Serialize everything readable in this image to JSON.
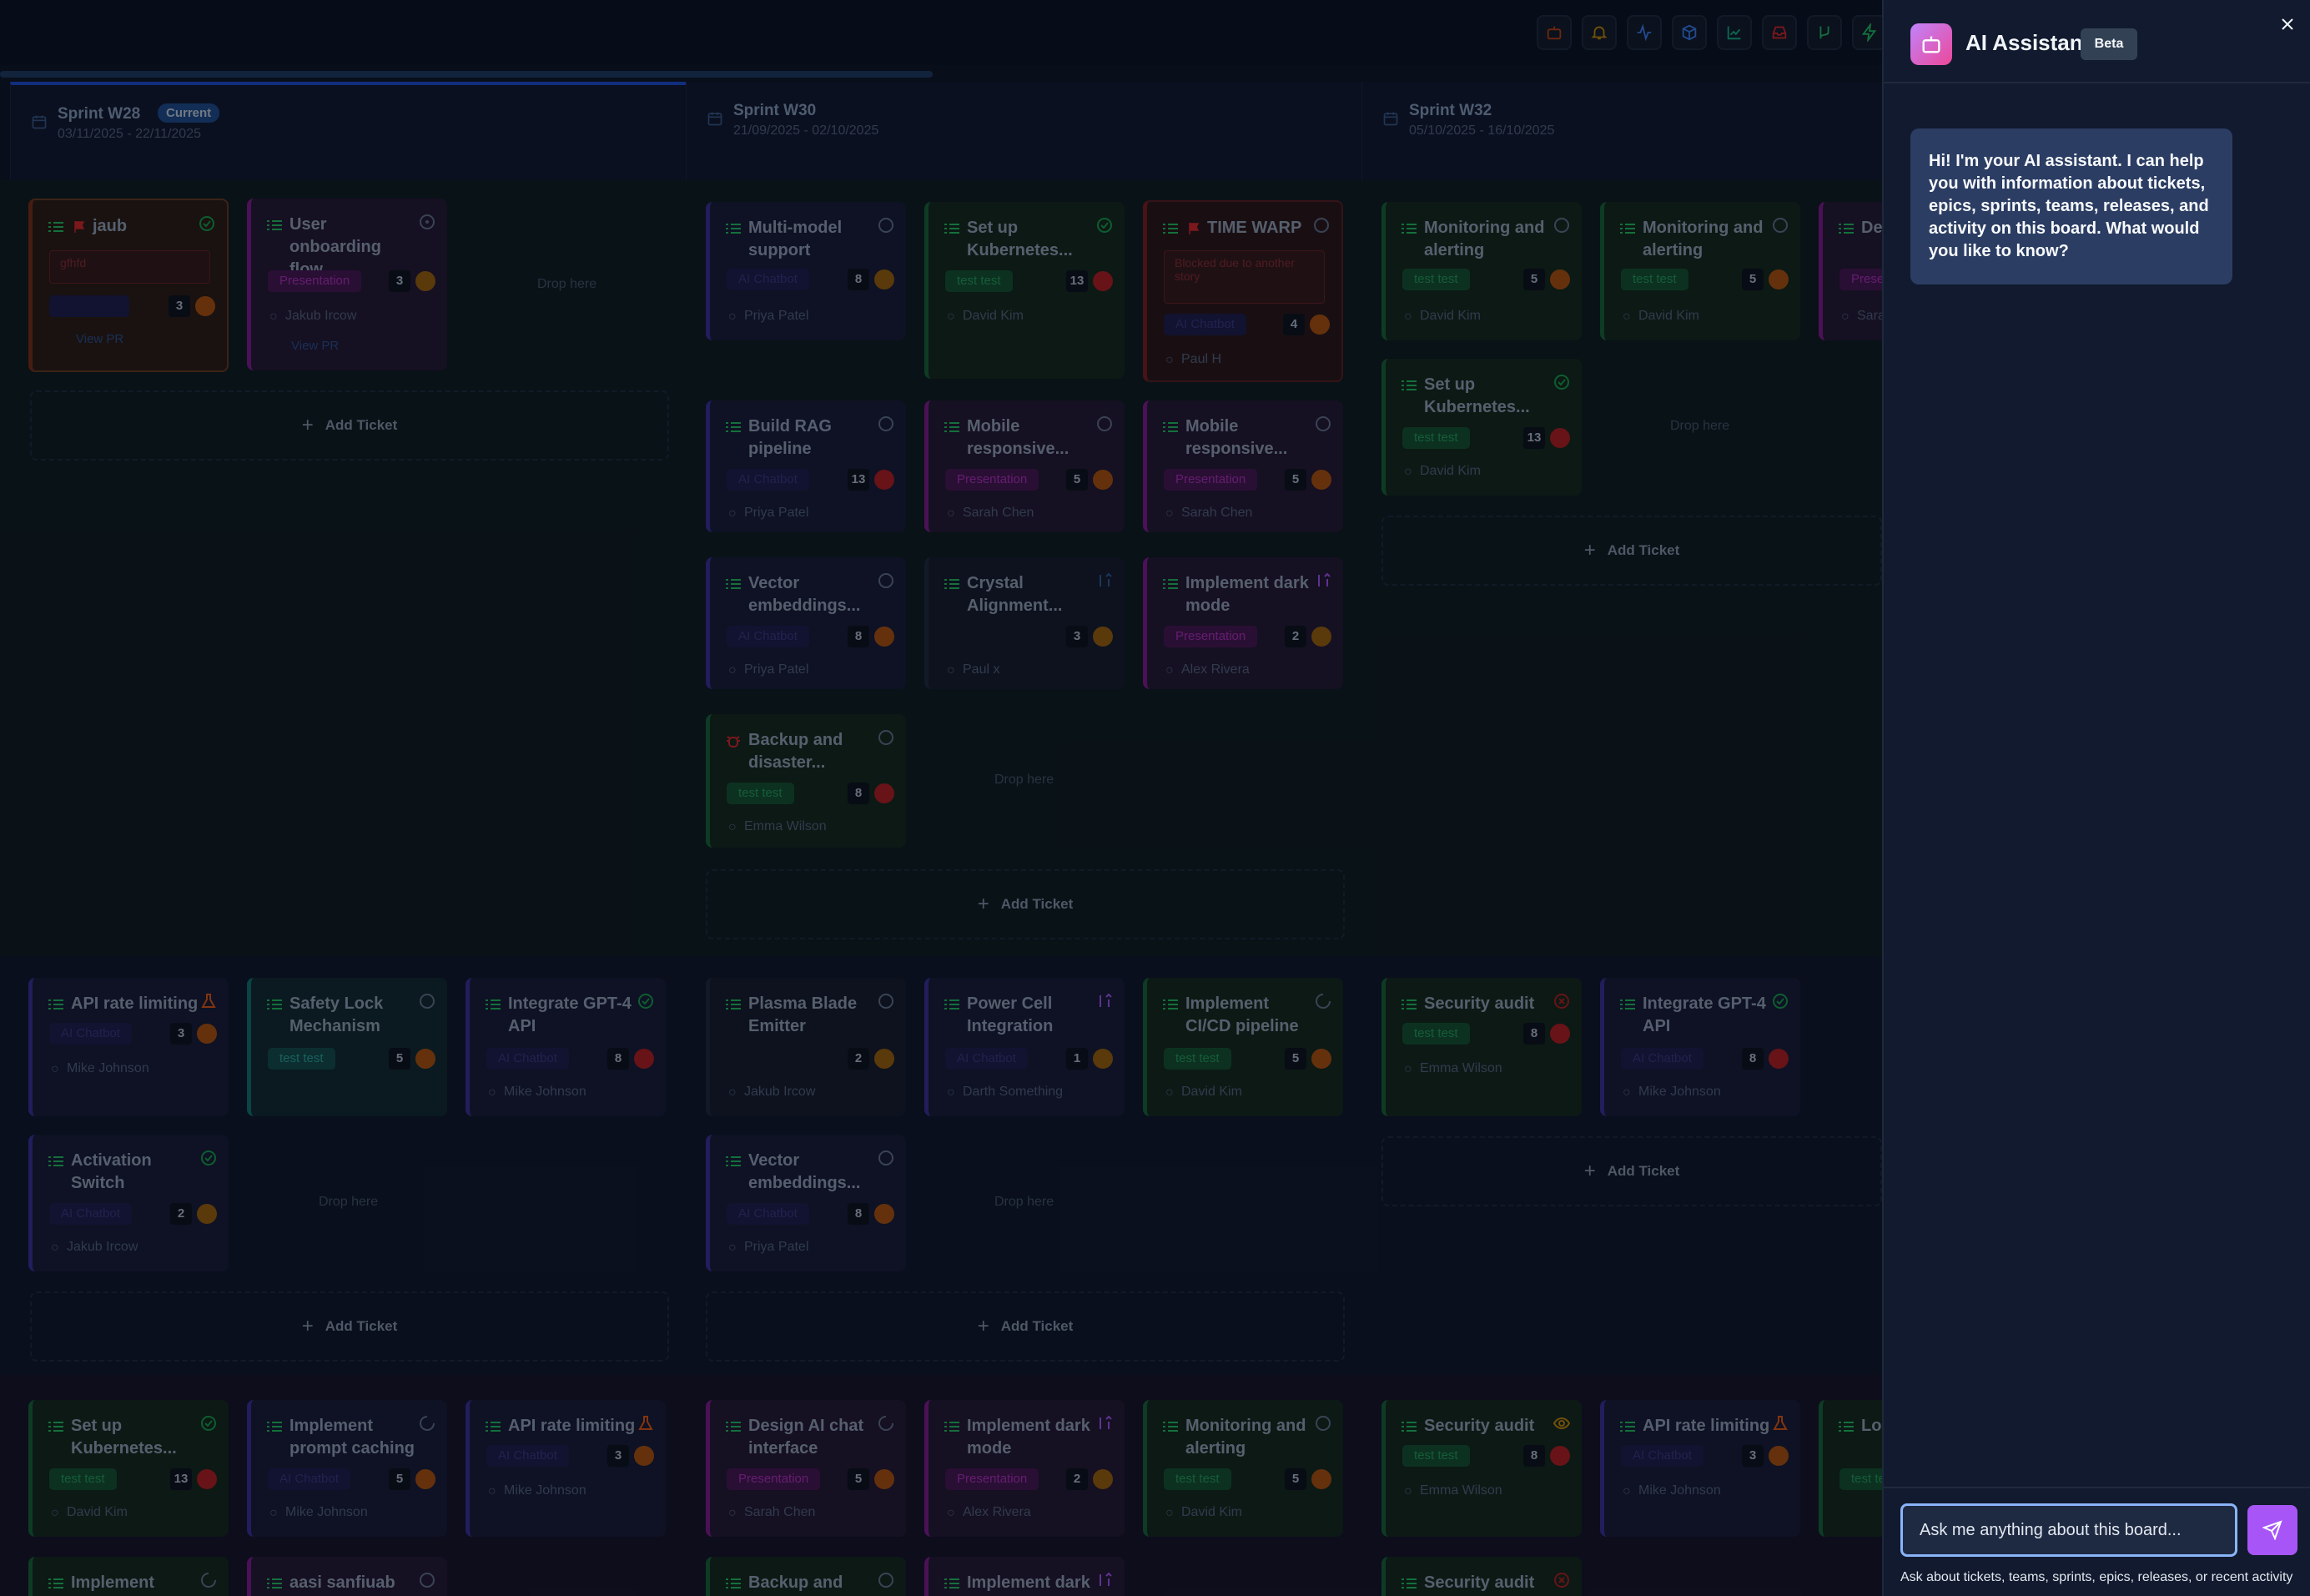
{
  "assistant": {
    "title": "AI Assistant",
    "badge": "Beta",
    "greeting": "Hi! I'm your AI assistant. I can help you with information about tickets, epics, sprints, teams, releases, and activity on this board. What would you like to know?",
    "input_placeholder": "Ask me anything about this board...",
    "hint": "Ask about tickets, teams, sprints, epics, releases, or recent activity"
  },
  "board": {
    "sprints": [
      {
        "name": "Sprint W28",
        "dates": "03/11/2025 - 22/11/2025",
        "badge": "Current"
      },
      {
        "name": "Sprint W30",
        "dates": "21/09/2025 - 02/10/2025"
      },
      {
        "name": "Sprint W32",
        "dates": "05/10/2025 - 16/10/2025"
      }
    ],
    "labels": {
      "drop_here": "Drop here",
      "add_ticket": "Add Ticket",
      "view_pr": "View PR"
    },
    "cards": [
      {
        "title": "jaub",
        "blocked": "gfhfd",
        "points": "3",
        "pr": "View PR"
      },
      {
        "title": "User onboarding flow",
        "tag": "Presentation",
        "points": "3",
        "assignee": "Jakub Ircow",
        "pr": "View PR"
      },
      {
        "title": "Multi-model support",
        "tag": "AI Chatbot",
        "points": "8",
        "assignee": "Priya Patel"
      },
      {
        "title": "Set up Kubernetes...",
        "tag": "test test",
        "points": "13",
        "assignee": "David Kim"
      },
      {
        "title": "TIME WARP",
        "blocked": "Blocked due to another story",
        "tag": "AI Chatbot",
        "points": "4",
        "assignee": "Paul H"
      },
      {
        "title": "Monitoring and alerting",
        "tag": "test test",
        "points": "5",
        "assignee": "David Kim"
      },
      {
        "title": "Monitoring and alerting",
        "tag": "test test",
        "points": "5",
        "assignee": "David Kim"
      },
      {
        "title": "De... int...",
        "tag": "Prese...",
        "assignee": "Sara..."
      },
      {
        "title": "Build RAG pipeline",
        "tag": "AI Chatbot",
        "points": "13",
        "assignee": "Priya Patel"
      },
      {
        "title": "Mobile responsive...",
        "tag": "Presentation",
        "points": "5",
        "assignee": "Sarah Chen"
      },
      {
        "title": "Mobile responsive...",
        "tag": "Presentation",
        "points": "5",
        "assignee": "Sarah Chen"
      },
      {
        "title": "Set up Kubernetes...",
        "tag": "test test",
        "points": "13",
        "assignee": "David Kim"
      },
      {
        "title": "Vector embeddings...",
        "tag": "AI Chatbot",
        "points": "8",
        "assignee": "Priya Patel"
      },
      {
        "title": "Crystal Alignment...",
        "points": "3",
        "assignee": "Paul x"
      },
      {
        "title": "Implement dark mode",
        "tag": "Presentation",
        "points": "2",
        "assignee": "Alex Rivera"
      },
      {
        "title": "Backup and disaster...",
        "tag": "test test",
        "points": "8",
        "assignee": "Emma Wilson"
      },
      {
        "title": "API rate limiting",
        "tag": "AI Chatbot",
        "points": "3",
        "assignee": "Mike Johnson"
      },
      {
        "title": "Safety Lock Mechanism",
        "tag": "test test",
        "points": "5"
      },
      {
        "title": "Integrate GPT-4 API",
        "tag": "AI Chatbot",
        "points": "8",
        "assignee": "Mike Johnson"
      },
      {
        "title": "Plasma Blade Emitter",
        "points": "2",
        "assignee": "Jakub Ircow"
      },
      {
        "title": "Power Cell Integration",
        "tag": "AI Chatbot",
        "points": "1",
        "assignee": "Darth Something"
      },
      {
        "title": "Implement CI/CD pipeline",
        "tag": "test test",
        "points": "5",
        "assignee": "David Kim"
      },
      {
        "title": "Security audit",
        "tag": "test test",
        "points": "8",
        "assignee": "Emma Wilson"
      },
      {
        "title": "Integrate GPT-4 API",
        "tag": "AI Chatbot",
        "points": "8",
        "assignee": "Mike Johnson"
      },
      {
        "title": "Activation Switch",
        "tag": "AI Chatbot",
        "points": "2",
        "assignee": "Jakub Ircow"
      },
      {
        "title": "Vector embeddings...",
        "tag": "AI Chatbot",
        "points": "8",
        "assignee": "Priya Patel"
      },
      {
        "title": "Set up Kubernetes...",
        "tag": "test test",
        "points": "13",
        "assignee": "David Kim"
      },
      {
        "title": "Implement prompt caching",
        "tag": "AI Chatbot",
        "points": "5",
        "assignee": "Mike Johnson"
      },
      {
        "title": "API rate limiting",
        "tag": "AI Chatbot",
        "points": "3",
        "assignee": "Mike Johnson"
      },
      {
        "title": "Design AI chat interface",
        "tag": "Presentation",
        "points": "5",
        "assignee": "Sarah Chen"
      },
      {
        "title": "Implement dark mode",
        "tag": "Presentation",
        "points": "2",
        "assignee": "Alex Rivera"
      },
      {
        "title": "Monitoring and alerting",
        "tag": "test test",
        "points": "5",
        "assignee": "David Kim"
      },
      {
        "title": "Security audit",
        "tag": "test test",
        "points": "8",
        "assignee": "Emma Wilson"
      },
      {
        "title": "API rate limiting",
        "tag": "AI Chatbot",
        "points": "3",
        "assignee": "Mike Johnson"
      },
      {
        "title": "Loa... set...",
        "tag": "test te..."
      },
      {
        "title": "Implement"
      },
      {
        "title": "aasi sanfiuab"
      },
      {
        "title": "Backup and"
      },
      {
        "title": "Implement dark"
      },
      {
        "title": "Security audit"
      }
    ]
  }
}
